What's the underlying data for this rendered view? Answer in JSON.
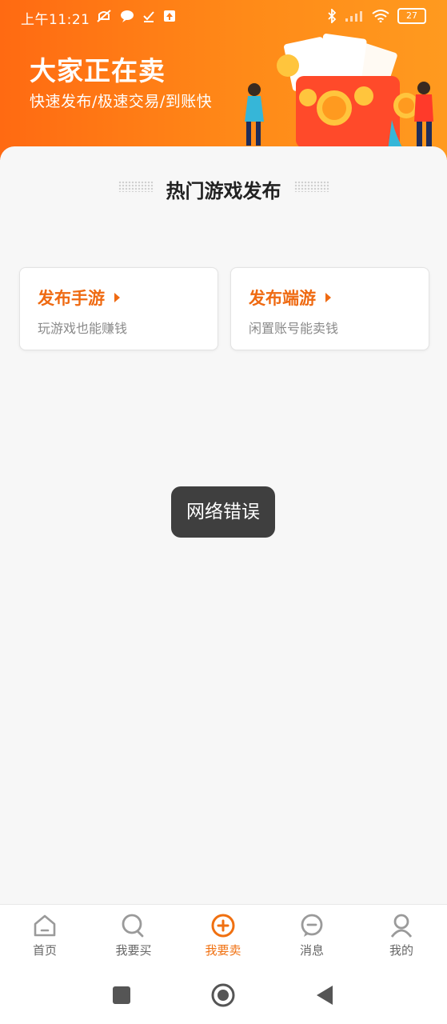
{
  "status": {
    "time": "上午11:21",
    "battery": "27"
  },
  "hero": {
    "title": "大家正在卖",
    "subtitle": "快速发布/极速交易/到账快"
  },
  "section": {
    "title": "热门游戏发布"
  },
  "cards": [
    {
      "title": "发布手游",
      "subtitle": "玩游戏也能赚钱"
    },
    {
      "title": "发布端游",
      "subtitle": "闲置账号能卖钱"
    }
  ],
  "toast": {
    "text": "网络错误"
  },
  "tabs": [
    {
      "label": "首页",
      "icon": "home-icon",
      "active": false
    },
    {
      "label": "我要买",
      "icon": "search-icon",
      "active": false
    },
    {
      "label": "我要卖",
      "icon": "plus-circle-icon",
      "active": true
    },
    {
      "label": "消息",
      "icon": "message-icon",
      "active": false
    },
    {
      "label": "我的",
      "icon": "user-icon",
      "active": false
    }
  ],
  "colors": {
    "accent": "#ef6a12",
    "hero_start": "#ff6a12",
    "hero_end": "#ff9a1f",
    "toast_bg": "#3f3f3f"
  }
}
